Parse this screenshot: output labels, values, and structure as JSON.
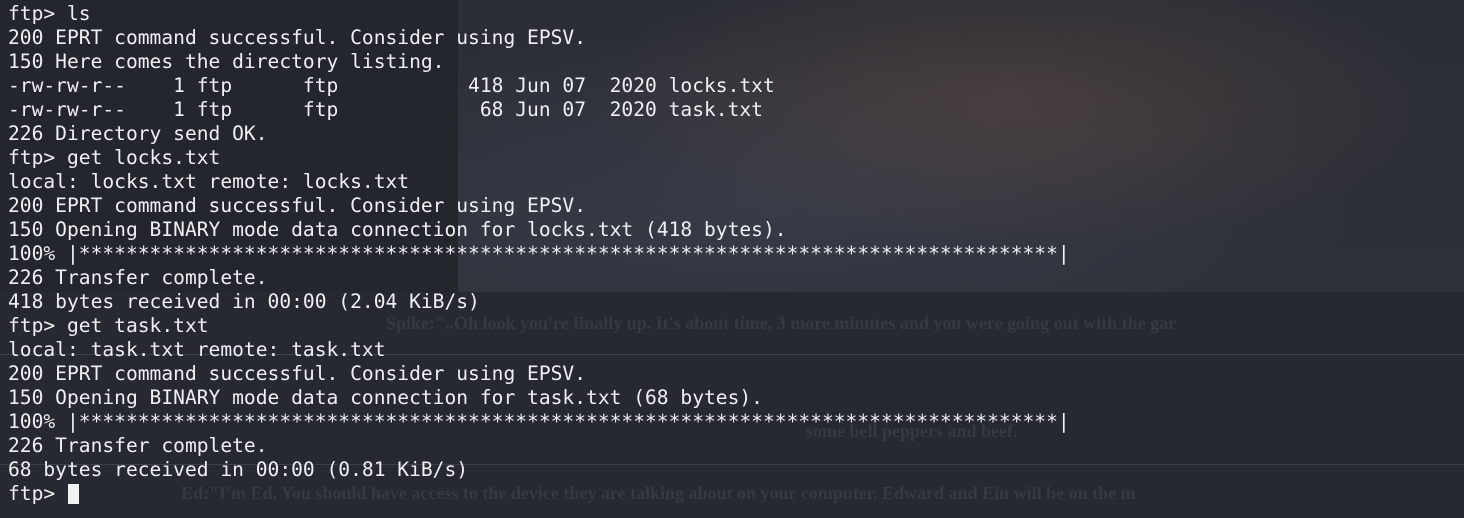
{
  "terminal": {
    "lines": [
      "ftp> ls",
      "200 EPRT command successful. Consider using EPSV.",
      "150 Here comes the directory listing.",
      "-rw-rw-r--    1 ftp      ftp           418 Jun 07  2020 locks.txt",
      "-rw-rw-r--    1 ftp      ftp            68 Jun 07  2020 task.txt",
      "226 Directory send OK.",
      "ftp> get locks.txt",
      "local: locks.txt remote: locks.txt",
      "200 EPRT command successful. Consider using EPSV.",
      "150 Opening BINARY mode data connection for locks.txt (418 bytes).",
      "100% |***********************************************************************************|",
      "226 Transfer complete.",
      "418 bytes received in 00:00 (2.04 KiB/s)",
      "ftp> get task.txt",
      "local: task.txt remote: task.txt",
      "200 EPRT command successful. Consider using EPSV.",
      "150 Opening BINARY mode data connection for task.txt (68 bytes).",
      "100% |***********************************************************************************|",
      "226 Transfer complete.",
      "68 bytes received in 00:00 (0.81 KiB/s)"
    ],
    "prompt": "ftp> "
  },
  "background": {
    "text_1": "Spike:\"..Oh look you're finally up. It's about time, 3 more minutes and you were going out with the gar",
    "text_2": "some bell peppers and beef.",
    "text_3": "Ed:\"I'm Ed. You should have access to the device they are talking about on your computer. Edward and Ein will be on the m"
  }
}
